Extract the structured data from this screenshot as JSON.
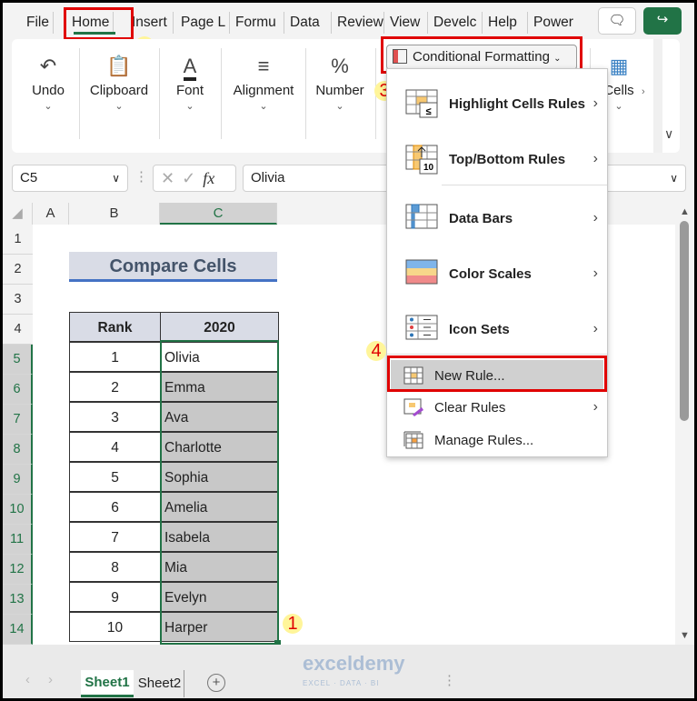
{
  "ribbon_tabs": [
    "File",
    "Home",
    "Insert",
    "Page L",
    "Formu",
    "Data",
    "Review",
    "View",
    "Develc",
    "Help",
    "Power"
  ],
  "active_tab": "Home",
  "groups": {
    "undo": "Undo",
    "clipboard": "Clipboard",
    "font": "Font",
    "alignment": "Alignment",
    "number": "Number",
    "cells": "Cells"
  },
  "conditional_formatting": "Conditional Formatting",
  "formula_bar": {
    "name_box": "C5",
    "value": "Olivia",
    "fx": "fx"
  },
  "columns": [
    "A",
    "B",
    "C"
  ],
  "rows": [
    "1",
    "2",
    "3",
    "4",
    "5",
    "6",
    "7",
    "8",
    "9",
    "10",
    "11",
    "12",
    "13",
    "14"
  ],
  "sheet": {
    "title": "Compare Cells",
    "headers": [
      "Rank",
      "2020"
    ],
    "data": [
      [
        "1",
        "Olivia"
      ],
      [
        "2",
        "Emma"
      ],
      [
        "3",
        "Ava"
      ],
      [
        "4",
        "Charlotte"
      ],
      [
        "5",
        "Sophia"
      ],
      [
        "6",
        "Amelia"
      ],
      [
        "7",
        "Isabela"
      ],
      [
        "8",
        "Mia"
      ],
      [
        "9",
        "Evelyn"
      ],
      [
        "10",
        "Harper"
      ]
    ]
  },
  "menu": {
    "items": [
      "Highlight Cells Rules",
      "Top/Bottom Rules",
      "Data Bars",
      "Color Scales",
      "Icon Sets",
      "New Rule...",
      "Clear Rules",
      "Manage Rules..."
    ],
    "highlighted": "New Rule..."
  },
  "steps": [
    "1",
    "2",
    "3",
    "4"
  ],
  "sheet_tabs": [
    "Sheet1",
    "Sheet2"
  ],
  "active_sheet": "Sheet1",
  "watermark": "exceldemy EXCEL · DATA · BI",
  "colors": {
    "excel_green": "#217346",
    "step_box": "#e00000",
    "selection": "#c8c8c8",
    "title_fill": "#d9dce6"
  }
}
